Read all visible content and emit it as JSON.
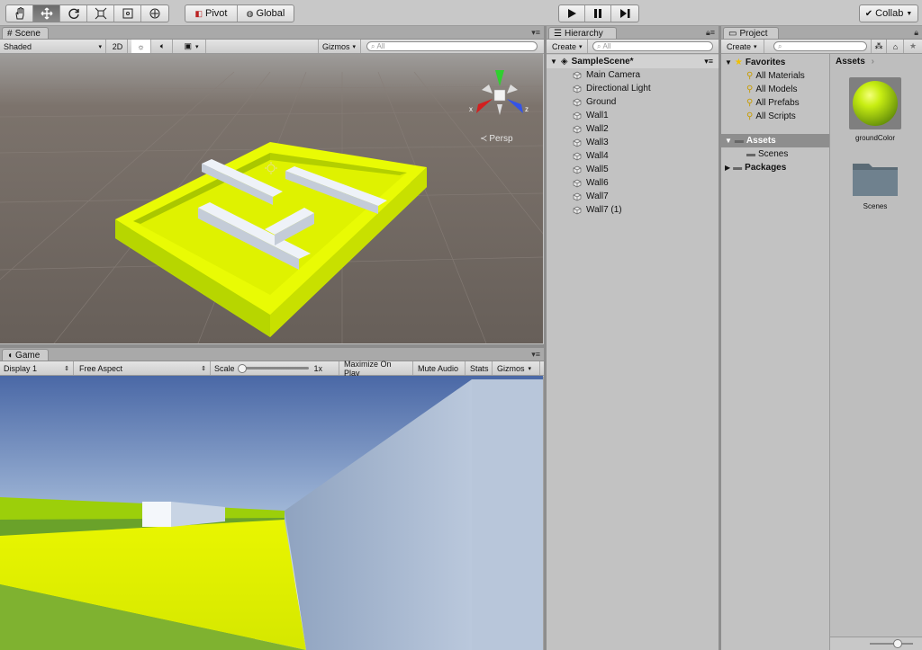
{
  "toolbar": {
    "tools": [
      "hand-tool",
      "move-tool",
      "rotate-tool",
      "scale-tool",
      "rect-tool",
      "transform-tool"
    ],
    "pivot_label": "Pivot",
    "global_label": "Global",
    "collab_label": "Collab"
  },
  "scene": {
    "tab_label": "Scene",
    "shading_mode": "Shaded",
    "mode_2d": "2D",
    "gizmos_label": "Gizmos",
    "search_placeholder": "All",
    "persp_label": "Persp",
    "axis_x": "x",
    "axis_z": "z"
  },
  "game": {
    "tab_label": "Game",
    "display": "Display 1",
    "aspect": "Free Aspect",
    "scale_label": "Scale",
    "scale_value": "1x",
    "maximize_label": "Maximize On Play",
    "mute_label": "Mute Audio",
    "stats_label": "Stats",
    "gizmos_label": "Gizmos"
  },
  "hierarchy": {
    "tab_label": "Hierarchy",
    "create_label": "Create",
    "search_placeholder": "All",
    "scene_name": "SampleScene*",
    "items": [
      "Main Camera",
      "Directional Light",
      "Ground",
      "Wall1",
      "Wall2",
      "Wall3",
      "Wall4",
      "Wall5",
      "Wall6",
      "Wall7",
      "Wall7 (1)"
    ]
  },
  "project": {
    "tab_label": "Project",
    "create_label": "Create",
    "favorites_label": "Favorites",
    "favorites": [
      "All Materials",
      "All Models",
      "All Prefabs",
      "All Scripts"
    ],
    "assets_label": "Assets",
    "scenes_label": "Scenes",
    "packages_label": "Packages",
    "breadcrumb": "Assets",
    "asset_items": [
      {
        "name": "groundColor",
        "type": "material"
      },
      {
        "name": "Scenes",
        "type": "folder"
      }
    ]
  },
  "colors": {
    "ground_yellow": "#e6f500",
    "ground_dark": "#aac800",
    "wall_white": "#e8ecf2",
    "scene_bg": "#6e645e",
    "sky_top": "#4b6aa8",
    "grass": "#6da12e"
  }
}
